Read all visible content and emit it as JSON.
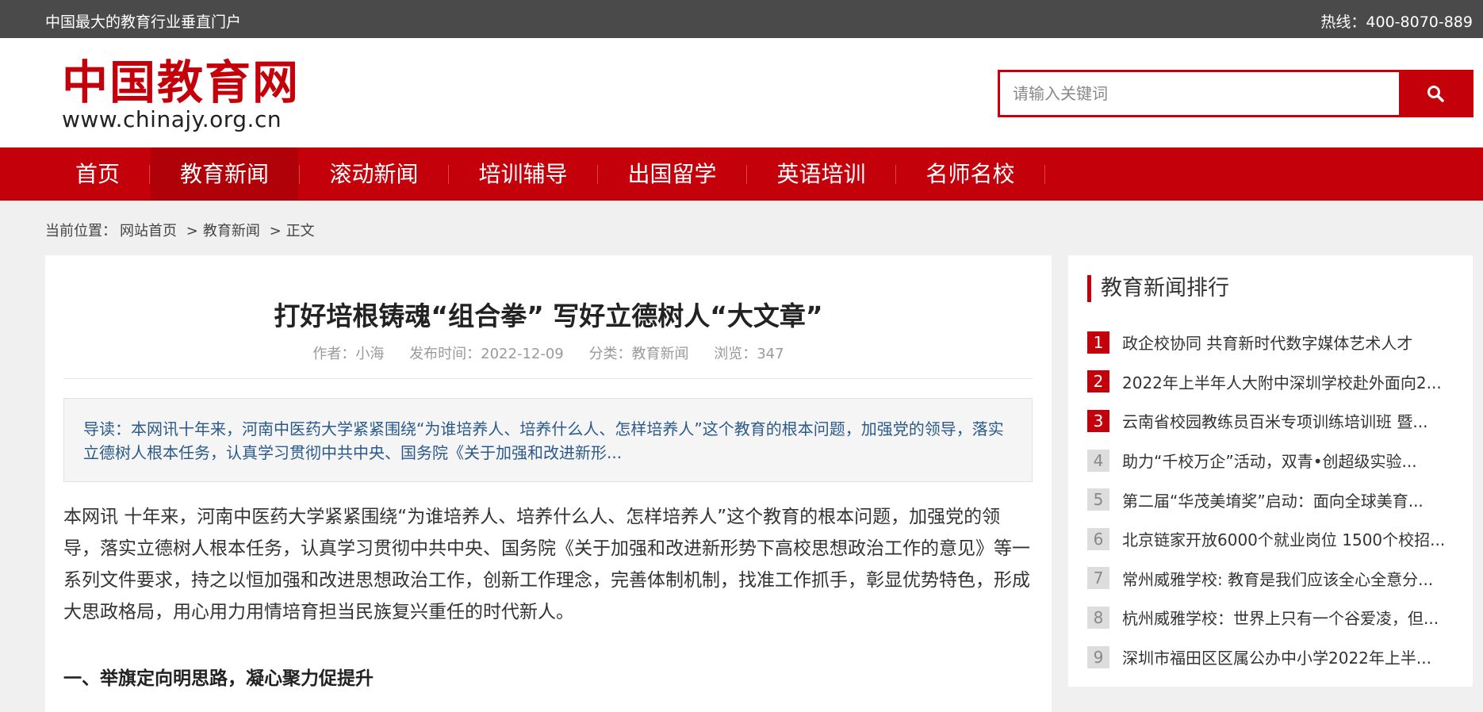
{
  "topbar": {
    "slogan": "中国最大的教育行业垂直门户",
    "hotline": "热线：400-8070-889"
  },
  "logo": {
    "name": "中国教育网",
    "url": "www.chinajy.org.cn"
  },
  "search": {
    "placeholder": "请输入关键词",
    "icon": "search-icon"
  },
  "nav": {
    "items": [
      {
        "label": "首页"
      },
      {
        "label": "教育新闻"
      },
      {
        "label": "滚动新闻"
      },
      {
        "label": "培训辅导"
      },
      {
        "label": "出国留学"
      },
      {
        "label": "英语培训"
      },
      {
        "label": "名师名校"
      }
    ],
    "active_index": 1
  },
  "breadcrumb": {
    "prefix": "当前位置：",
    "home": "网站首页",
    "sep": ">",
    "category": "教育新闻",
    "current": "正文"
  },
  "article": {
    "title": "打好培根铸魂“组合拳” 写好立德树人“大文章”",
    "meta": {
      "author": "作者：小海",
      "date": "发布时间：2022-12-09",
      "category": "分类：教育新闻",
      "views": "浏览：347"
    },
    "intro": "导读：本网讯十年来，河南中医药大学紧紧围绕“为谁培养人、培养什么人、怎样培养人”这个教育的根本问题，加强党的领导，落实立德树人根本任务，认真学习贯彻中共中央、国务院《关于加强和改进新形...",
    "body": "本网讯 十年来，河南中医药大学紧紧围绕“为谁培养人、培养什么人、怎样培养人”这个教育的根本问题，加强党的领导，落实立德树人根本任务，认真学习贯彻中共中央、国务院《关于加强和改进新形势下高校思想政治工作的意见》等一系列文件要求，持之以恒加强和改进思想政治工作，创新工作理念，完善体制机制，找准工作抓手，彰显优势特色，形成大思政格局，用心用力用情培育担当民族复兴重任的时代新人。",
    "subhead": "一、举旗定向明思路，凝心聚力促提升"
  },
  "sidebar": {
    "title": "教育新闻排行",
    "items": [
      {
        "num": "1",
        "title": "政企校协同 共育新时代数字媒体艺术人才"
      },
      {
        "num": "2",
        "title": "2022年上半年人大附中深圳学校赴外面向2..."
      },
      {
        "num": "3",
        "title": "云南省校园教练员百米专项训练培训班 暨..."
      },
      {
        "num": "4",
        "title": "助力“千校万企”活动，双青•创超级实验..."
      },
      {
        "num": "5",
        "title": "第二届“华茂美堉奖”启动：面向全球美育..."
      },
      {
        "num": "6",
        "title": "北京链家开放6000个就业岗位 1500个校招..."
      },
      {
        "num": "7",
        "title": "常州威雅学校: 教育是我们应该全心全意分..."
      },
      {
        "num": "8",
        "title": "杭州威雅学校：世界上只有一个谷爱凌，但..."
      },
      {
        "num": "9",
        "title": "深圳市福田区区属公办中小学2022年上半..."
      }
    ]
  },
  "colors": {
    "brand_red": "#c4000b",
    "topbar_bg": "#4a4a4a",
    "intro_text": "#2b5a8a"
  }
}
